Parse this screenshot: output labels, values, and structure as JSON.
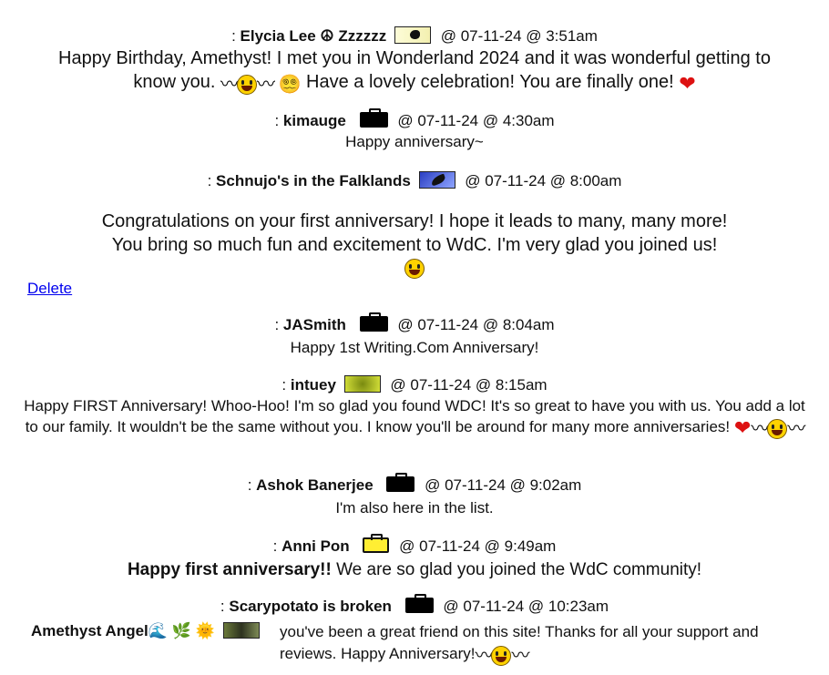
{
  "entries": [
    {
      "prefix": ":",
      "author": "Elycia Lee ☮ Zzzzzz",
      "timestamp": "@ 07-11-24 @ 3:51am",
      "message": "Happy Birthday, Amethyst! I met you in Wonderland 2024 and it was wonderful getting to know you.",
      "message2": "Have a lovely celebration! You are finally one!"
    },
    {
      "prefix": ":",
      "author": "kimauge",
      "timestamp": "@ 07-11-24 @ 4:30am",
      "message": "Happy anniversary~"
    },
    {
      "prefix": ":",
      "author": "Schnujo's in the Falklands",
      "timestamp": "@ 07-11-24 @ 8:00am",
      "message": "Congratulations on your first anniversary! I hope it leads to many, many more! You bring so much fun and excitement to WdC. I'm very glad you joined us!"
    },
    {
      "prefix": ":",
      "author": "JASmith",
      "timestamp": "@ 07-11-24 @ 8:04am",
      "message": "Happy 1st Writing.Com Anniversary!"
    },
    {
      "prefix": ":",
      "author": "intuey",
      "timestamp": "@ 07-11-24 @ 8:15am",
      "message": "Happy FIRST Anniversary! Whoo-Hoo! I'm so glad you found WDC! It's so great to have you with us. You add a lot to our family. It wouldn't be the same without you. I know you'll be around for many more anniversaries!"
    },
    {
      "prefix": ":",
      "author": "Ashok Banerjee",
      "timestamp": "@ 07-11-24 @ 9:02am",
      "message": "I'm also here in the list."
    },
    {
      "prefix": ":",
      "author": "Anni Pon",
      "timestamp": "@ 07-11-24 @ 9:49am",
      "message_bold": "Happy first anniversary!!",
      "message": "We are so glad you joined the WdC community!"
    },
    {
      "prefix": ":",
      "author": "Scarypotato is broken",
      "timestamp": "@ 07-11-24 @ 10:23am",
      "signature": "Amethyst Angel",
      "message": "you've been a great friend on this site! Thanks for all your support and reviews. Happy Anniversary!"
    }
  ],
  "delete_link": "Delete",
  "colors": {
    "link": "#0000ee",
    "heart": "#dd1111",
    "badge_yellow": "#ffee33"
  }
}
